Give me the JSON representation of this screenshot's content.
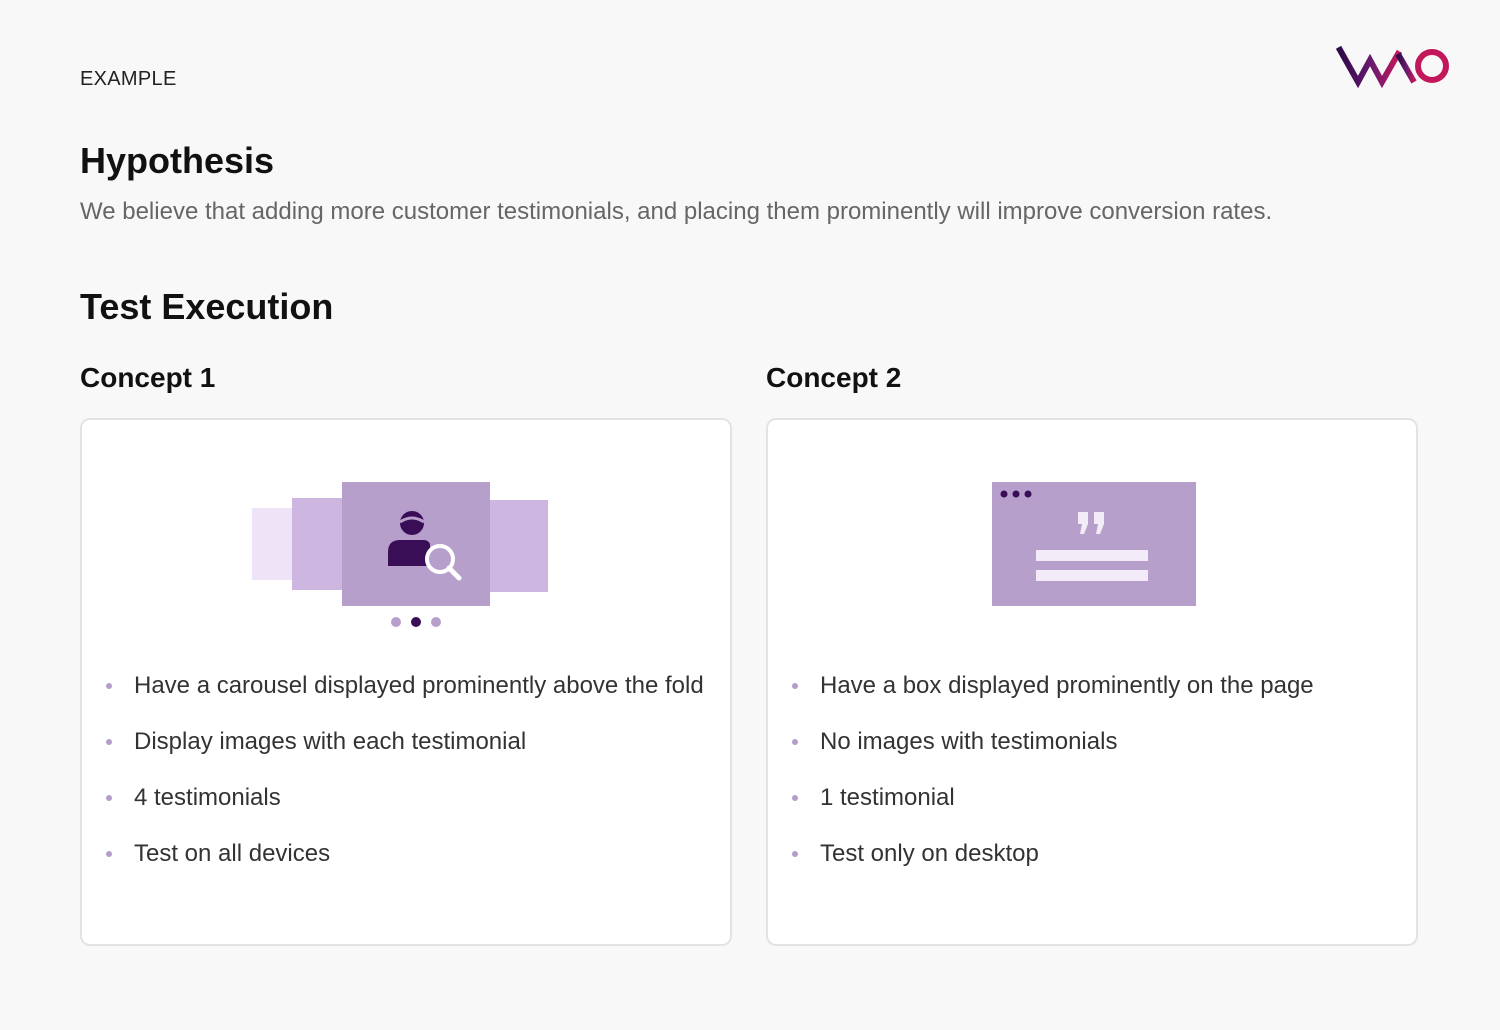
{
  "header": {
    "eyebrow": "EXAMPLE",
    "logo_icon": "vwo-logo",
    "logo_colors": [
      "#2e0a4a",
      "#c2185b"
    ]
  },
  "hypothesis": {
    "title": "Hypothesis",
    "text": "We believe that adding more customer testimonials, and placing them prominently will improve conversion rates."
  },
  "execution": {
    "title": "Test Execution",
    "concepts": [
      {
        "title": "Concept 1",
        "illustration_icon": "carousel-user-search-icon",
        "items": [
          "Have a carousel displayed prominently above the fold",
          "Display images with each testimonial",
          "4 testimonials",
          "Test on all devices"
        ]
      },
      {
        "title": "Concept 2",
        "illustration_icon": "quote-box-icon",
        "items": [
          "Have a box displayed prominently on the page",
          "No images with testimonials",
          "1 testimonial",
          "Test only on desktop"
        ]
      }
    ]
  },
  "colors": {
    "background": "#f8f8f8",
    "card_border": "#e3e3e3",
    "accent_light": "#cdb6e0",
    "accent_mid": "#b69fcb",
    "accent_dark": "#3a0d57",
    "bullet": "#b59ccb"
  }
}
